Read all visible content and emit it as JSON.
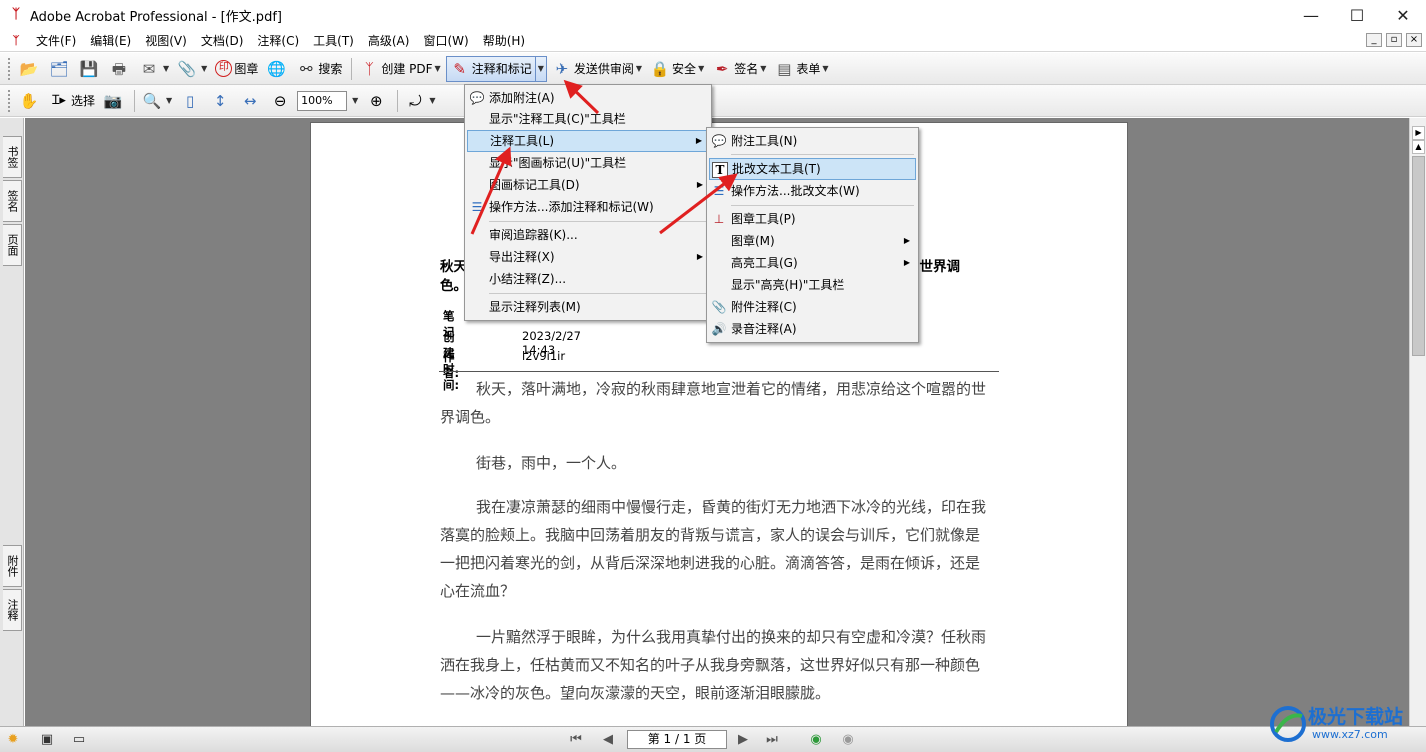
{
  "window": {
    "title": "Adobe Acrobat Professional - [作文.pdf]",
    "controls": {
      "minimize": "—",
      "maximize": "☐",
      "close": "✕"
    }
  },
  "menubar": {
    "items": [
      "文件(F)",
      "编辑(E)",
      "视图(V)",
      "文档(D)",
      "注释(C)",
      "工具(T)",
      "高级(A)",
      "窗口(W)",
      "帮助(H)"
    ],
    "mdi_controls": [
      "_",
      "▫",
      "×"
    ]
  },
  "toolbar1": {
    "stamp_label": "图章",
    "search_label": "搜索",
    "create_pdf_label": "创建 PDF",
    "comment_markup_label": "注释和标记",
    "send_review_label": "发送供审阅",
    "security_label": "安全",
    "sign_label": "签名",
    "forms_label": "表单"
  },
  "toolbar2": {
    "select_label": "选择",
    "zoom_value": "100%"
  },
  "left_tabs": {
    "bookmarks": "书签",
    "signatures": "签名",
    "pages": "页面",
    "attachments": "附件",
    "comments": "注释"
  },
  "comment_menu": {
    "items": [
      {
        "label": "添加附注(A)",
        "icon": "note-icon"
      },
      {
        "label": "显示\"注释工具(C)\"工具栏"
      },
      {
        "label": "注释工具(L)",
        "submenu": true
      },
      {
        "label": "显示\"图画标记(U)\"工具栏"
      },
      {
        "label": "图画标记工具(D)",
        "submenu": true
      },
      {
        "label": "操作方法...添加注释和标记(W)",
        "icon": "howto-icon"
      },
      {
        "label": "审阅追踪器(K)..."
      },
      {
        "label": "导出注释(X)",
        "submenu": true
      },
      {
        "label": "小结注释(Z)..."
      },
      {
        "label": "显示注释列表(M)"
      }
    ]
  },
  "tools_submenu": {
    "items": [
      {
        "label": "附注工具(N)",
        "icon": "note-icon"
      },
      {
        "label": "批改文本工具(T)",
        "icon": "text-edit-icon"
      },
      {
        "label": "操作方法...批改文本(W)",
        "icon": "howto-icon"
      },
      {
        "label": "图章工具(P)",
        "icon": "stamp-icon"
      },
      {
        "label": "图章(M)",
        "submenu": true
      },
      {
        "label": "高亮工具(G)",
        "submenu": true
      },
      {
        "label": "显示\"高亮(H)\"工具栏"
      },
      {
        "label": "附件注释(C)",
        "icon": "paperclip-icon"
      },
      {
        "label": "录音注释(A)",
        "icon": "speaker-icon"
      }
    ]
  },
  "document": {
    "heading_start": "秋天",
    "heading_end": "的世界调",
    "heading_line2": "色。",
    "meta": [
      {
        "key": "笔记",
        "value": ""
      },
      {
        "key": "创建时间:",
        "value": "2023/2/27 14:43"
      },
      {
        "key": "作者:",
        "value": "l2v9i1ir"
      }
    ],
    "paragraphs": [
      "秋天，落叶满地，冷寂的秋雨肆意地宣泄着它的情绪，用悲凉给这个喧嚣的世界调色。",
      "街巷，雨中，一个人。",
      "我在凄凉萧瑟的细雨中慢慢行走，昏黄的街灯无力地洒下冰冷的光线，印在我落寞的脸颊上。我脑中回荡着朋友的背叛与谎言，家人的误会与训斥，它们就像是一把把闪着寒光的剑，从背后深深地刺进我的心脏。滴滴答答，是雨在倾诉，还是心在流血？",
      "一片黯然浮于眼眸，为什么我用真挚付出的换来的却只有空虚和冷漠？任秋雨洒在我身上，任枯黄而又不知名的叶子从我身旁飘落，这世界好似只有那一种颜色——冰冷的灰色。望向灰濛濛的天空，眼前逐渐泪眼朦胧。"
    ]
  },
  "statusbar": {
    "page_display": "第 1 / 1 页"
  },
  "watermark": {
    "brand": "极光下载站",
    "url": "www.xz7.com"
  },
  "colors": {
    "highlight": "#cce4f7",
    "highlight_border": "#6ea6d8",
    "arrow_red": "#e02020",
    "doc_bg": "#808080"
  }
}
